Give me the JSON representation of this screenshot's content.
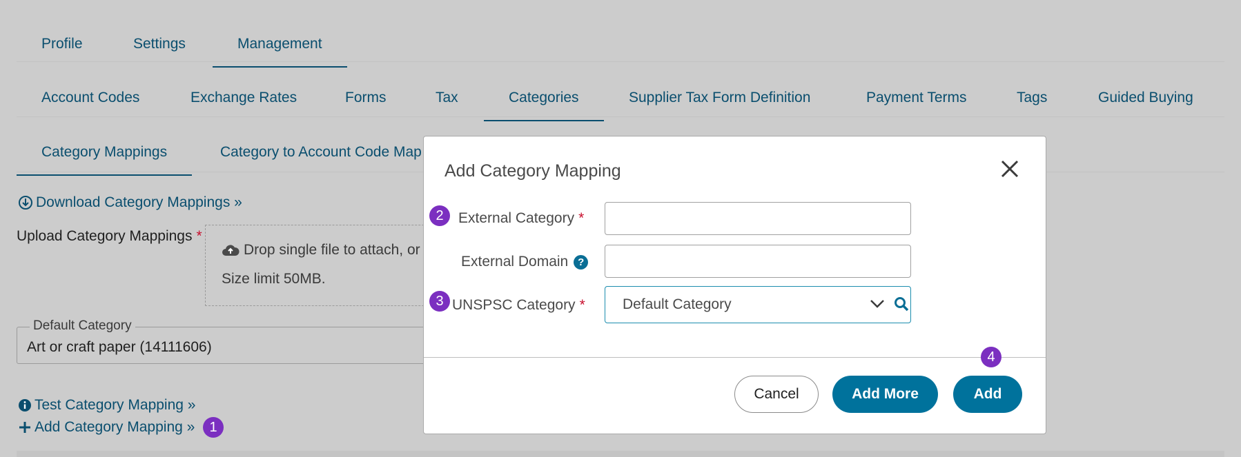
{
  "top_tabs": [
    "Profile",
    "Settings",
    "Management"
  ],
  "mgmt_tabs": [
    "Account Codes",
    "Exchange Rates",
    "Forms",
    "Tax",
    "Categories",
    "Supplier Tax Form Definition",
    "Payment Terms",
    "Tags",
    "Guided Buying"
  ],
  "category_tabs": [
    "Category Mappings",
    "Category to Account Code Map"
  ],
  "download_link": "Download Category Mappings »",
  "upload": {
    "label": "Upload Category Mappings",
    "required": "*",
    "drop_text": "Drop single file to attach, or",
    "size_limit": "Size limit 50MB."
  },
  "default_category": {
    "legend": "Default Category",
    "value": "Art or craft paper (14111606)"
  },
  "test_link": "Test Category Mapping »",
  "add_link": "Add Category Mapping »",
  "badges": [
    "1",
    "2",
    "3",
    "4"
  ],
  "modal": {
    "title": "Add Category Mapping",
    "external_category_label": "External Category",
    "external_domain_label": "External Domain",
    "unspsc_label": "UNSPSC Category",
    "required": "*",
    "help_glyph": "?",
    "external_category_value": "",
    "external_domain_value": "",
    "unspsc_value": "Default Category",
    "cancel": "Cancel",
    "add_more": "Add More",
    "add": "Add"
  },
  "colors": {
    "accent": "#00729c",
    "link": "#0a4e6e",
    "badge": "#7b2fc0",
    "required": "#c8102e"
  }
}
